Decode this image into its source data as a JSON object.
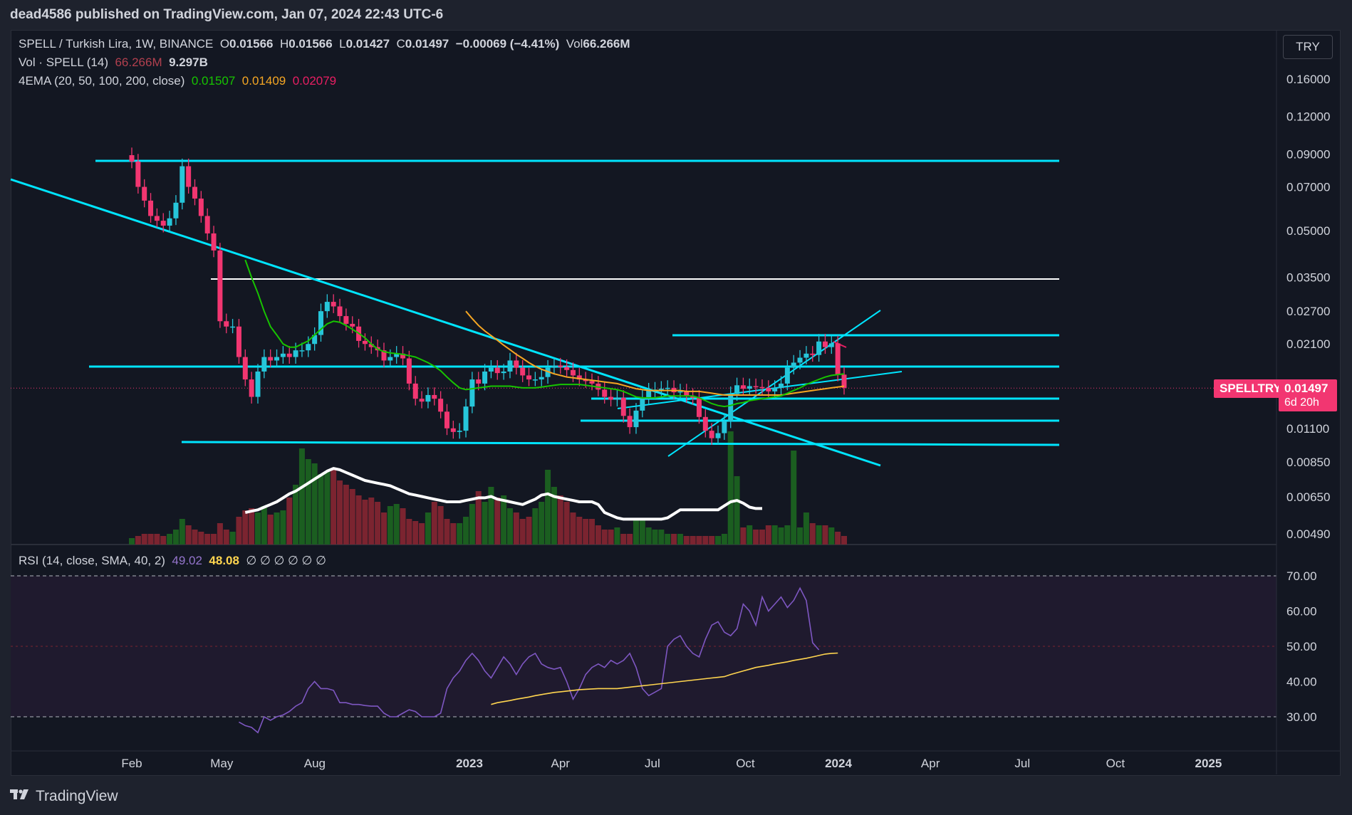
{
  "header": {
    "publisher": "dead4586 published on TradingView.com, Jan 07, 2024 22:43 UTC-6"
  },
  "footer": {
    "logo_text": "TradingView"
  },
  "currency_button": "TRY",
  "legend": {
    "symbol": "SPELL / Turkish Lira, 1W, BINANCE",
    "open_label": "O",
    "open": "0.01566",
    "high_label": "H",
    "high": "0.01566",
    "low_label": "L",
    "low": "0.01427",
    "close_label": "C",
    "close": "0.01497",
    "change": "−0.00069 (−4.41%)",
    "vol_label": "Vol",
    "vol": "66.266M",
    "vol_ind": "Vol · SPELL (14)",
    "vol_ind_v1": "66.266M",
    "vol_ind_v2": "9.297B",
    "ema_label": "4EMA (20, 50, 100, 200, close)",
    "ema20": "0.01507",
    "ema50": "0.01409",
    "ema200": "0.02079",
    "rsi_label": "RSI (14, close, SMA, 40, 2)",
    "rsi_value": "49.02",
    "rsi_sma": "48.08",
    "rsi_empty": "∅ ∅ ∅ ∅ ∅ ∅"
  },
  "price_tag": {
    "symbol": "SPELLTRY",
    "price": "0.01497",
    "countdown": "6d 20h"
  },
  "colors": {
    "up": "#26c6da",
    "down": "#f23671",
    "ema20": "#17c400",
    "ema50": "#f5a623",
    "ema200": "#e91e63",
    "hline": "#00e5ff",
    "white_line": "#ffffff",
    "rsi": "#7e57c2",
    "rsi_sma": "#ffd54f",
    "vol_up": "#1b5e20",
    "vol_down": "#7b2430"
  },
  "chart_data": [
    {
      "type": "candlestick",
      "title": "SPELL / Turkish Lira, 1W, BINANCE",
      "scale": "log",
      "price_ticks": [
        0.16,
        0.12,
        0.09,
        0.07,
        0.05,
        0.035,
        0.027,
        0.021,
        0.011,
        0.0085,
        0.0065,
        0.0049
      ],
      "price_tick_labels": [
        "0.16000",
        "0.12000",
        "0.09000",
        "0.07000",
        "0.05000",
        "0.03500",
        "0.02700",
        "0.02100",
        "0.01100",
        "0.00850",
        "0.00650",
        "0.00490"
      ],
      "time_ticks": [
        {
          "label": "Feb",
          "date": "2022-02-01",
          "bold": false
        },
        {
          "label": "May",
          "date": "2022-05-01",
          "bold": false
        },
        {
          "label": "Aug",
          "date": "2022-08-01",
          "bold": false
        },
        {
          "label": "2023",
          "date": "2023-01-01",
          "bold": true
        },
        {
          "label": "Apr",
          "date": "2023-04-01",
          "bold": false
        },
        {
          "label": "Jul",
          "date": "2023-07-01",
          "bold": false
        },
        {
          "label": "Oct",
          "date": "2023-10-01",
          "bold": false
        },
        {
          "label": "2024",
          "date": "2024-01-01",
          "bold": true
        },
        {
          "label": "Apr",
          "date": "2024-04-01",
          "bold": false
        },
        {
          "label": "Jul",
          "date": "2024-07-01",
          "bold": false
        },
        {
          "label": "Oct",
          "date": "2024-10-01",
          "bold": false
        },
        {
          "label": "2025",
          "date": "2025-01-01",
          "bold": true
        }
      ],
      "last_price": 0.01497,
      "close_series": [
        0.085,
        0.07,
        0.063,
        0.056,
        0.054,
        0.052,
        0.055,
        0.062,
        0.082,
        0.07,
        0.064,
        0.056,
        0.049,
        0.043,
        0.025,
        0.024,
        0.024,
        0.019,
        0.016,
        0.014,
        0.017,
        0.019,
        0.0185,
        0.019,
        0.0195,
        0.019,
        0.02,
        0.02,
        0.021,
        0.0225,
        0.027,
        0.029,
        0.028,
        0.026,
        0.0245,
        0.024,
        0.0215,
        0.021,
        0.0205,
        0.02,
        0.0185,
        0.019,
        0.0195,
        0.0188,
        0.0155,
        0.0138,
        0.0135,
        0.0142,
        0.0138,
        0.0125,
        0.011,
        0.0107,
        0.0108,
        0.013,
        0.016,
        0.0155,
        0.017,
        0.0175,
        0.0168,
        0.017,
        0.0185,
        0.0175,
        0.0165,
        0.016,
        0.016,
        0.0163,
        0.0175,
        0.0178,
        0.0176,
        0.0172,
        0.0165,
        0.016,
        0.0158,
        0.0155,
        0.0148,
        0.014,
        0.0137,
        0.0139,
        0.0121,
        0.0111,
        0.0126,
        0.0139,
        0.0147,
        0.0148,
        0.0149,
        0.015,
        0.0145,
        0.0146,
        0.0141,
        0.0139,
        0.012,
        0.0108,
        0.0102,
        0.0106,
        0.0116,
        0.0143,
        0.0153,
        0.0149,
        0.0152,
        0.0151,
        0.015,
        0.0146,
        0.015,
        0.0155,
        0.0175,
        0.0182,
        0.0189,
        0.0195,
        0.0193,
        0.0214,
        0.0205,
        0.0211,
        0.0166,
        0.015
      ],
      "ema20": [
        null,
        null,
        null,
        null,
        null,
        null,
        null,
        null,
        null,
        null,
        null,
        null,
        null,
        null,
        null,
        null,
        null,
        null,
        0.04,
        0.035,
        0.031,
        0.027,
        0.024,
        0.0225,
        0.021,
        0.0205,
        0.0205,
        0.021,
        0.0215,
        0.0225,
        0.0235,
        0.0245,
        0.025,
        0.0248,
        0.0242,
        0.0235,
        0.0228,
        0.022,
        0.021,
        0.0202,
        0.0198,
        0.0196,
        0.0195,
        0.0194,
        0.0192,
        0.019,
        0.0186,
        0.0182,
        0.0177,
        0.0171,
        0.0163,
        0.0156,
        0.015,
        0.0148,
        0.0149,
        0.015,
        0.0151,
        0.0152,
        0.0152,
        0.0152,
        0.0152,
        0.0151,
        0.015,
        0.015,
        0.015,
        0.0151,
        0.0152,
        0.0153,
        0.0154,
        0.0154,
        0.0154,
        0.0154,
        0.0153,
        0.0152,
        0.0151,
        0.015,
        0.0149,
        0.0148,
        0.0146,
        0.0143,
        0.014,
        0.0139,
        0.0139,
        0.0139,
        0.014,
        0.0141,
        0.0141,
        0.0141,
        0.0141,
        0.0141,
        0.0139,
        0.0136,
        0.0133,
        0.0131,
        0.013,
        0.0131,
        0.0133,
        0.0134,
        0.0136,
        0.0137,
        0.0138,
        0.0139,
        0.014,
        0.0141,
        0.0144,
        0.0147,
        0.015,
        0.0154,
        0.0157,
        0.016,
        0.0163,
        0.0165,
        0.0166,
        0.0167
      ],
      "ema50": [
        null,
        null,
        null,
        null,
        null,
        null,
        null,
        null,
        null,
        null,
        null,
        null,
        null,
        null,
        null,
        null,
        null,
        null,
        null,
        null,
        null,
        null,
        null,
        null,
        null,
        null,
        null,
        null,
        null,
        null,
        null,
        null,
        null,
        null,
        null,
        null,
        null,
        null,
        null,
        null,
        null,
        null,
        null,
        null,
        null,
        null,
        null,
        null,
        null,
        null,
        null,
        null,
        null,
        0.027,
        0.0255,
        0.0242,
        0.0232,
        0.0224,
        0.0216,
        0.0208,
        0.0201,
        0.0194,
        0.0188,
        0.0182,
        0.0177,
        0.0173,
        0.017,
        0.0167,
        0.0165,
        0.0163,
        0.0162,
        0.0161,
        0.016,
        0.0159,
        0.0158,
        0.0157,
        0.0156,
        0.0155,
        0.0153,
        0.0151,
        0.0149,
        0.0148,
        0.0147,
        0.0147,
        0.0147,
        0.0147,
        0.0147,
        0.0147,
        0.0146,
        0.0146,
        0.0146,
        0.0145,
        0.0144,
        0.0143,
        0.0142,
        0.0142,
        0.0142,
        0.0142,
        0.0142,
        0.0142,
        0.0142,
        0.0142,
        0.0142,
        0.0142,
        0.0143,
        0.0144,
        0.0145,
        0.0146,
        0.0147,
        0.0148,
        0.0149,
        0.015,
        0.0151,
        0.0152
      ],
      "volume_series": [
        3,
        4,
        5,
        5,
        5,
        4,
        5,
        7,
        12,
        9,
        7,
        6,
        5,
        5,
        10,
        7,
        6,
        13,
        16,
        17,
        15,
        18,
        14,
        15,
        16,
        22,
        28,
        45,
        40,
        38,
        33,
        34,
        35,
        30,
        28,
        26,
        23,
        21,
        22,
        20,
        15,
        18,
        19,
        17,
        12,
        11,
        10,
        15,
        20,
        18,
        12,
        10,
        10,
        13,
        19,
        25,
        20,
        27,
        22,
        23,
        17,
        15,
        12,
        13,
        17,
        20,
        35,
        27,
        23,
        20,
        15,
        13,
        12,
        12,
        9,
        7,
        7,
        8,
        5,
        5,
        12,
        12,
        8,
        7,
        7,
        5,
        5,
        5,
        4,
        4,
        4,
        4,
        4,
        4,
        5,
        53,
        32,
        8,
        9,
        7,
        7,
        9,
        9,
        8,
        9,
        44,
        8,
        15,
        10,
        9,
        9,
        8,
        6,
        4
      ],
      "volume_ma": [
        null,
        null,
        null,
        null,
        null,
        null,
        null,
        null,
        null,
        null,
        null,
        null,
        null,
        null,
        null,
        null,
        null,
        null,
        12,
        12.5,
        13,
        14,
        15,
        16,
        17.5,
        19,
        20,
        21.5,
        23,
        24.5,
        26,
        27.5,
        28.5,
        28,
        27,
        26,
        25,
        24,
        23.5,
        23,
        22.5,
        22,
        21,
        20,
        19,
        18.5,
        18,
        17.5,
        17,
        16.5,
        16,
        16,
        16,
        16.5,
        17,
        17.5,
        17.5,
        18,
        17,
        16.5,
        16,
        15.5,
        15,
        16,
        17,
        18.5,
        19,
        18,
        17.5,
        17,
        16.5,
        16,
        16,
        16,
        15,
        12,
        11,
        10,
        9.5,
        9.5,
        9.5,
        9.5,
        9.5,
        9.5,
        9.5,
        10,
        11.5,
        13,
        13,
        13,
        13,
        13,
        13,
        13,
        14.5,
        16,
        16.5,
        15.5,
        14,
        13.5,
        13.5
      ]
    },
    {
      "type": "line",
      "title": "RSI (14, close, SMA, 40, 2)",
      "ylim": [
        25,
        75
      ],
      "y_ticks": [
        70,
        60,
        50,
        40,
        30
      ],
      "y_tick_labels": [
        "70.00",
        "60.00",
        "50.00",
        "40.00",
        "30.00"
      ],
      "upper_band": 70,
      "middle_band": 50,
      "lower_band": 30,
      "rsi": [
        null,
        null,
        null,
        null,
        null,
        null,
        null,
        null,
        null,
        null,
        null,
        null,
        null,
        null,
        null,
        null,
        null,
        28.5,
        27.5,
        27,
        25.5,
        30,
        29,
        30,
        30.5,
        31.5,
        33,
        34,
        38,
        40,
        38,
        38,
        37.5,
        34,
        34,
        33.5,
        33.5,
        33.2,
        33,
        33,
        31,
        30,
        30,
        31,
        32,
        31.5,
        30,
        30,
        30,
        31,
        38,
        41,
        43,
        46,
        48,
        46,
        43,
        41,
        44,
        47,
        45,
        42,
        45,
        47,
        48,
        45,
        44,
        43.5,
        44,
        40,
        35,
        38,
        42,
        44,
        45,
        44,
        46,
        45,
        46,
        48,
        44,
        38,
        36,
        37,
        38,
        50,
        52,
        53,
        50,
        48,
        47,
        52,
        56,
        57,
        54,
        53,
        55,
        62,
        60,
        56,
        64,
        60,
        62,
        64,
        61,
        63,
        66.5,
        63,
        51,
        49
      ],
      "rsi_sma": [
        null,
        null,
        null,
        null,
        null,
        null,
        null,
        null,
        null,
        null,
        null,
        null,
        null,
        null,
        null,
        null,
        null,
        null,
        null,
        null,
        null,
        null,
        null,
        null,
        null,
        null,
        null,
        null,
        null,
        null,
        null,
        null,
        null,
        null,
        null,
        null,
        null,
        null,
        null,
        null,
        null,
        null,
        null,
        null,
        null,
        null,
        null,
        null,
        null,
        null,
        null,
        null,
        null,
        null,
        null,
        null,
        null,
        33.5,
        34,
        34.3,
        34.6,
        35,
        35.3,
        35.6,
        36,
        36.3,
        36.6,
        36.9,
        37.1,
        37.3,
        37.5,
        37.7,
        37.8,
        37.9,
        38,
        38,
        38,
        38,
        38.2,
        38.4,
        38.6,
        38.8,
        39,
        39.2,
        39.4,
        39.6,
        39.8,
        40,
        40.2,
        40.4,
        40.6,
        40.8,
        41,
        41.2,
        41.4,
        42,
        42.5,
        43,
        43.5,
        44,
        44.3,
        44.6,
        45,
        45.3,
        45.6,
        46,
        46.3,
        46.6,
        47,
        47.4,
        47.8,
        48,
        48.08
      ]
    }
  ]
}
